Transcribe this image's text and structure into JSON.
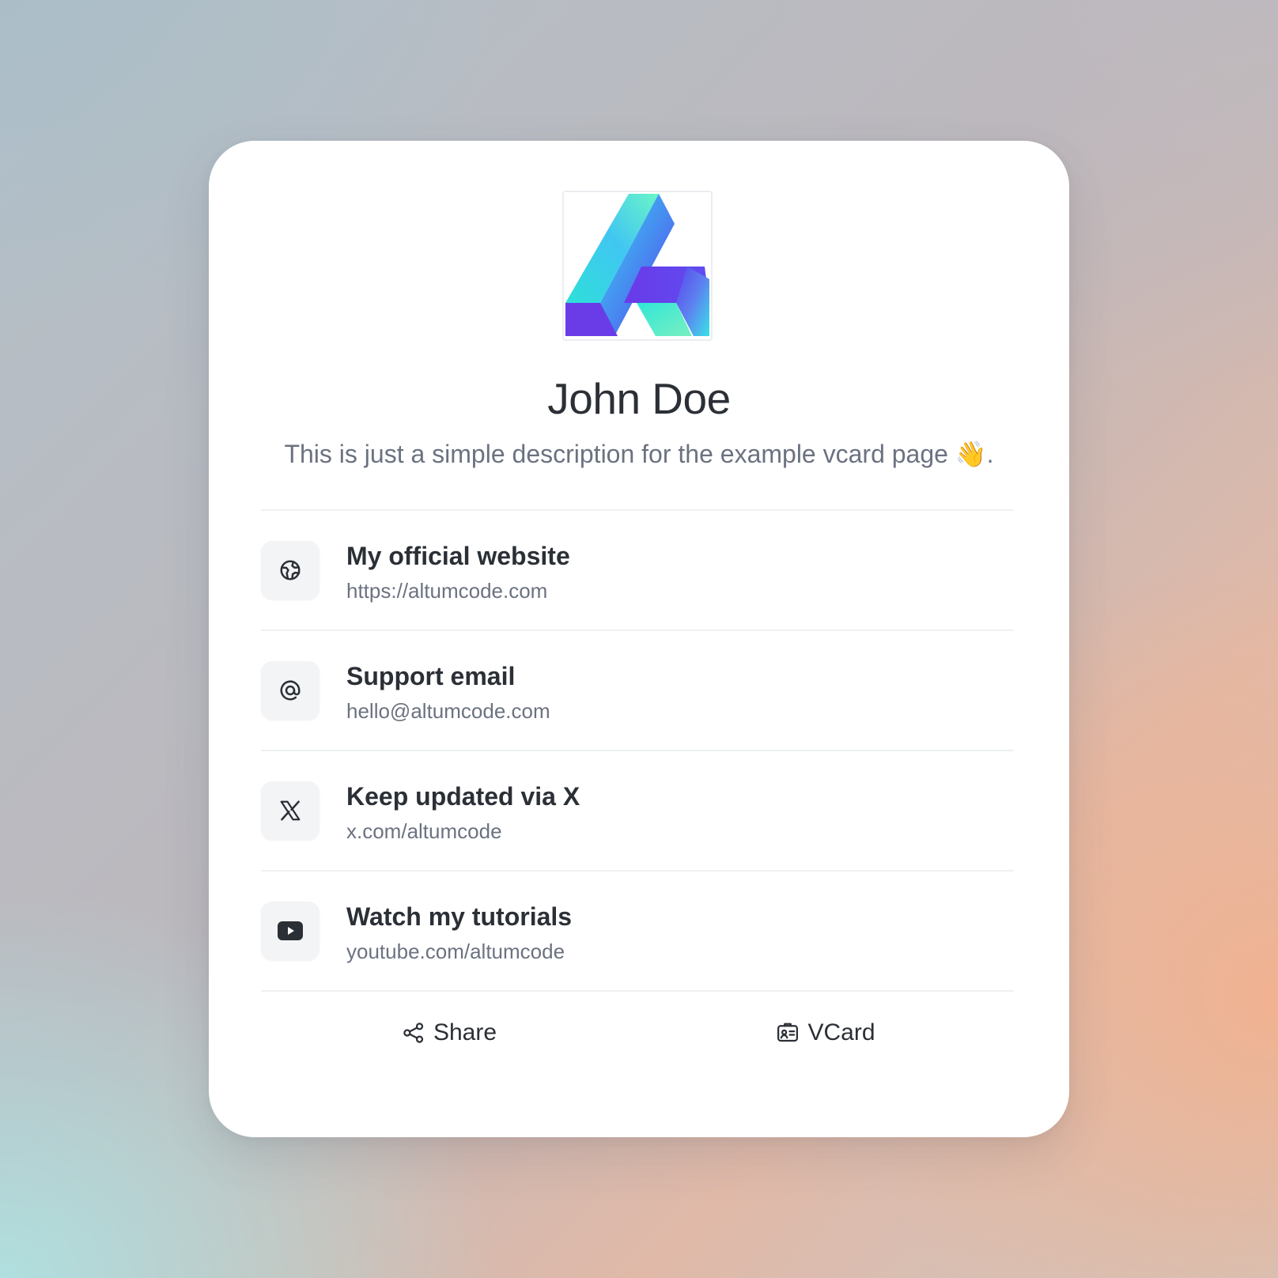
{
  "profile": {
    "name": "John Doe",
    "description": "This is just a simple description for the example vcard page 👋."
  },
  "links": [
    {
      "title": "My official website",
      "subtitle": "https://altumcode.com",
      "icon": "globe-icon"
    },
    {
      "title": "Support email",
      "subtitle": "hello@altumcode.com",
      "icon": "at-icon"
    },
    {
      "title": "Keep updated via X",
      "subtitle": "x.com/altumcode",
      "icon": "x-icon"
    },
    {
      "title": "Watch my tutorials",
      "subtitle": "youtube.com/altumcode",
      "icon": "youtube-icon"
    }
  ],
  "actions": {
    "share_label": "Share",
    "vcard_label": "VCard"
  },
  "colors": {
    "text_primary": "#2b2f36",
    "text_secondary": "#6b7280",
    "icon_bg": "#f3f4f6",
    "logo_gradient": [
      "#5ef3c7",
      "#3bbdf0",
      "#6236e8"
    ]
  }
}
